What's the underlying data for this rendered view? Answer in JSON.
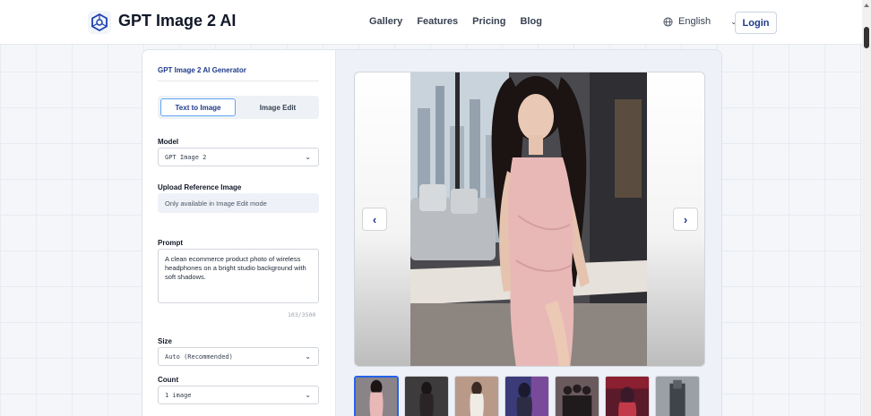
{
  "header": {
    "brand": "GPT Image 2 AI",
    "nav": [
      "Gallery",
      "Features",
      "Pricing",
      "Blog"
    ],
    "language": "English",
    "login_label": "Login",
    "logo_icon": "hexagon-logo-icon",
    "globe_icon": "globe-icon"
  },
  "generator": {
    "title": "GPT Image 2 AI Generator",
    "tabs": [
      {
        "label": "Text to Image",
        "active": true
      },
      {
        "label": "Image Edit",
        "active": false
      }
    ],
    "model": {
      "label": "Model",
      "value": "GPT Image 2"
    },
    "upload": {
      "label": "Upload Reference Image",
      "note": "Only available in Image Edit mode"
    },
    "prompt": {
      "label": "Prompt",
      "value": "A clean ecommerce product photo of wireless headphones on a bright studio background with soft shadows.",
      "counter": "103/3500"
    },
    "size": {
      "label": "Size",
      "value": "Auto (Recommended)"
    },
    "count": {
      "label": "Count",
      "value": "1 image"
    }
  },
  "preview": {
    "prev_icon": "chevron-left-icon",
    "next_icon": "chevron-right-icon",
    "thumbnail_count": 7,
    "selected_thumbnail": 1
  },
  "colors": {
    "accent": "#1e3a8a",
    "tab_border": "#60a5fa",
    "selected_thumb": "#2563eb"
  }
}
